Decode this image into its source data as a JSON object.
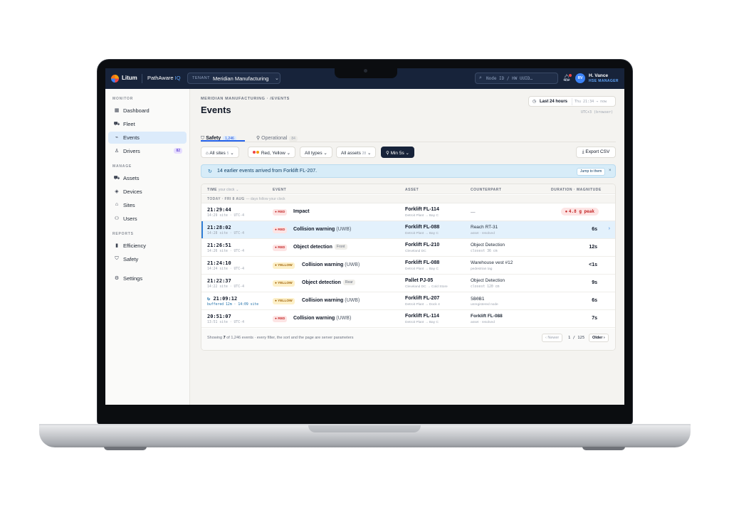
{
  "topbar": {
    "brand": "Litum",
    "product": "PathAware",
    "product_suffix": "IQ",
    "tenant_label": "TENANT",
    "tenant_value": "Meridian Manufacturing",
    "search_placeholder": "Node ID / HW UUID…",
    "user_initials": "RV",
    "user_name": "H. Vance",
    "user_role": "HSE MANAGER"
  },
  "sidebar": {
    "sections": [
      "MONITOR",
      "MANAGE",
      "REPORTS"
    ],
    "monitor": [
      {
        "label": "Dashboard",
        "icon": "dashboard-icon"
      },
      {
        "label": "Fleet",
        "icon": "forklift-icon"
      },
      {
        "label": "Events",
        "icon": "pulse-icon"
      },
      {
        "label": "Drivers",
        "icon": "person-icon",
        "badge": "82"
      }
    ],
    "manage": [
      {
        "label": "Assets",
        "icon": "forklift-icon"
      },
      {
        "label": "Devices",
        "icon": "layers-icon"
      },
      {
        "label": "Sites",
        "icon": "home-icon"
      },
      {
        "label": "Users",
        "icon": "users-icon"
      }
    ],
    "reports": [
      {
        "label": "Efficiency",
        "icon": "bar-chart-icon"
      },
      {
        "label": "Safety",
        "icon": "shield-icon"
      }
    ],
    "settings": {
      "label": "Settings",
      "icon": "gear-icon"
    }
  },
  "header": {
    "breadcrumb": "MERIDIAN MANUFACTURING · /EVENTS",
    "title": "Events",
    "range_label": "Last 24 hours",
    "range_time": "Thu 21:34 → now",
    "timezone": "UTC+3 (browser)"
  },
  "tabs": [
    {
      "label": "Safety",
      "count": "1,246"
    },
    {
      "label": "Operational",
      "count": "84"
    }
  ],
  "filters": {
    "sites": "All sites",
    "sites_count": "5",
    "severity": "Red, Yellow",
    "types": "All types",
    "assets": "All assets",
    "assets_count": "28",
    "min": "Min 5s",
    "export": "Export CSV"
  },
  "banner": {
    "text": "14 earlier events arrived from Forklift FL-207.",
    "action": "Jump to them"
  },
  "table": {
    "headers": {
      "time": "TIME",
      "time_sub": "your clock",
      "event": "EVENT",
      "asset": "ASSET",
      "counterpart": "COUNTERPART",
      "duration": "DURATION · MAGNITUDE"
    },
    "day_group": "TODAY · FRI 8 AUG",
    "day_hint": "— days follow your clock",
    "rows": [
      {
        "time": "21:29:44",
        "site_time": "14:29 site · UTC-4",
        "severity": "RED",
        "event": "Impact",
        "asset": "Forklift FL-114",
        "route": "Detroit Plant → Bay C",
        "counterpart": "—",
        "counterpart_sub": "",
        "duration": "4.8 g peak"
      },
      {
        "time": "21:28:02",
        "site_time": "14:28 site · UTC-4",
        "severity": "RED",
        "event": "Collision warning",
        "uwb": "(UWB)",
        "asset": "Forklift FL-088",
        "route": "Detroit Plant → Bay C",
        "counterpart": "Reach RT-31",
        "counterpart_sub": "asset · resolved",
        "duration": "6s"
      },
      {
        "time": "21:26:51",
        "site_time": "14:26 site · UTC-4",
        "severity": "RED",
        "event": "Object detection",
        "tag": "Front",
        "asset": "Forklift FL-210",
        "route": "Cleveland DC",
        "counterpart": "Object Detection",
        "counterpart_sub": "closest 36 cm",
        "duration": "12s"
      },
      {
        "time": "21:24:10",
        "site_time": "14:24 site · UTC-4",
        "severity": "YELLOW",
        "event": "Collision warning",
        "uwb": "(UWB)",
        "asset": "Forklift FL-088",
        "route": "Detroit Plant → Bay C",
        "counterpart": "Warehouse vest #12",
        "counterpart_sub": "pedestrian tag",
        "duration": "<1s"
      },
      {
        "time": "21:22:37",
        "site_time": "14:22 site · UTC-4",
        "severity": "YELLOW",
        "event": "Object detection",
        "tag": "Rear",
        "asset": "Pallet PJ-05",
        "route": "Cleveland DC → Cold Store",
        "counterpart": "Object Detection",
        "counterpart_sub": "closest 120 cm",
        "duration": "9s"
      },
      {
        "time": "21:09:12",
        "site_time": "buffered 12m · 14:09 site",
        "severity": "YELLOW",
        "event": "Collision warning",
        "uwb": "(UWB)",
        "asset": "Forklift FL-207",
        "route": "Detroit Plant → Dock 4",
        "counterpart": "5B0B1",
        "counterpart_sub": "unregistered node",
        "duration": "6s"
      },
      {
        "time": "20:51:07",
        "site_time": "13:51 site · UTC-4",
        "severity": "RED",
        "event": "Collision warning",
        "uwb": "(UWB)",
        "asset": "Forklift FL-114",
        "route": "Detroit Plant → Bay C",
        "counterpart": "Forklift FL-088",
        "counterpart_sub": "asset · resolved",
        "duration": "7s"
      }
    ],
    "footer_prefix": "Showing",
    "footer_count": "7",
    "footer_suffix": "of 1,246 events · every filter, the sort and the page are server parameters",
    "newer": "‹ Newer",
    "page": "1 / 125",
    "older": "Older ›"
  },
  "colors": {
    "navy": "#17233a",
    "accent": "#2563eb",
    "red": "#c52a2a",
    "yellow": "#a16207"
  }
}
